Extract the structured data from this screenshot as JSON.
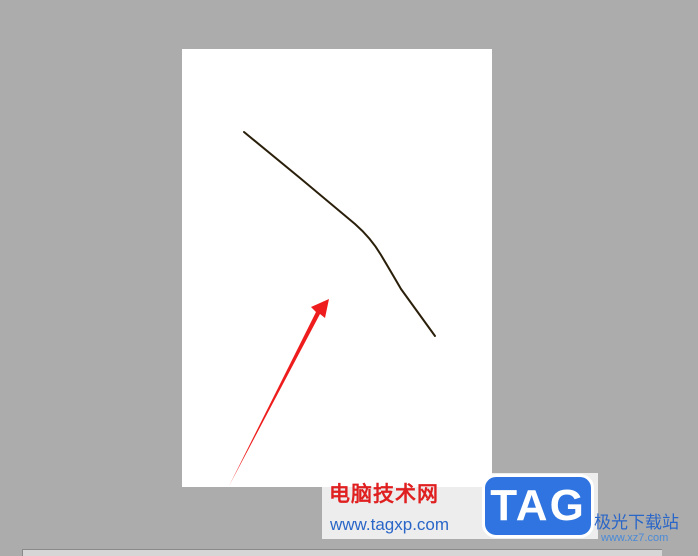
{
  "watermark": {
    "title": "电脑技术网",
    "url": "www.tagxp.com",
    "badge": "TAG",
    "site_name": "极光下载站",
    "site_url": "www.xz7.com",
    "title_color": "#e02020",
    "url_color": "#2a66c8",
    "badge_color": "#2f74e0"
  },
  "colors": {
    "workspace": "#acacac",
    "page": "#ffffff",
    "stroke": "#2a1f0a",
    "arrow": "#ee1c1c"
  }
}
